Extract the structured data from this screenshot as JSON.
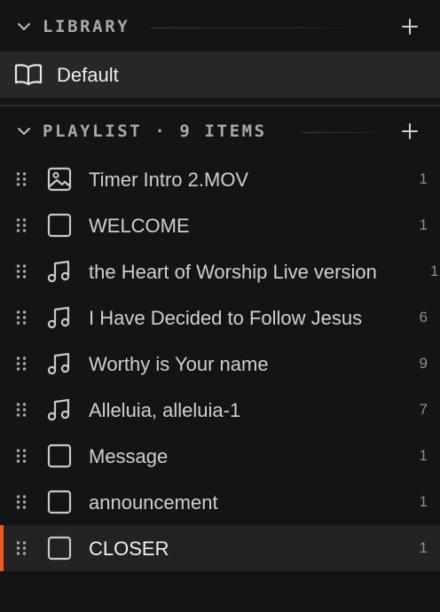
{
  "library": {
    "title": "LIBRARY",
    "items": [
      {
        "label": "Default",
        "icon": "book-icon"
      }
    ]
  },
  "playlist": {
    "title": "PLAYLIST · 9 ITEMS",
    "items": [
      {
        "label": "Timer Intro 2.MOV",
        "count": "1",
        "icon": "image-icon"
      },
      {
        "label": "WELCOME",
        "count": "1",
        "icon": "slide-icon"
      },
      {
        "label": "the Heart of Worship Live version",
        "count": "1",
        "icon": "music-icon"
      },
      {
        "label": "I Have Decided to Follow Jesus",
        "count": "6",
        "icon": "music-icon"
      },
      {
        "label": "Worthy is Your name",
        "count": "9",
        "icon": "music-icon"
      },
      {
        "label": "Alleluia, alleluia-1",
        "count": "7",
        "icon": "music-icon"
      },
      {
        "label": "Message",
        "count": "1",
        "icon": "slide-icon"
      },
      {
        "label": "announcement",
        "count": "1",
        "icon": "slide-icon"
      },
      {
        "label": "CLOSER",
        "count": "1",
        "icon": "slide-icon",
        "selected": true
      }
    ]
  },
  "colors": {
    "background": "#141416",
    "selected_row": "#222225",
    "library_row": "#27272a",
    "accent": "#e85b22",
    "header_text": "#a9a9ab"
  }
}
